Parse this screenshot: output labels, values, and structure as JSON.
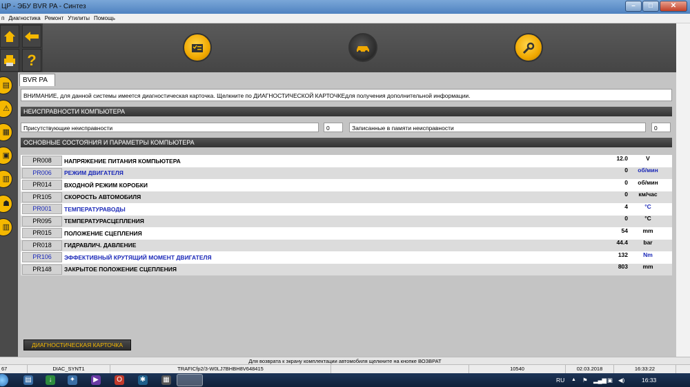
{
  "window": {
    "title": "ЦР - ЭБУ BVR PA - Синтез",
    "controls": {
      "minimize": "–",
      "maximize": "□",
      "close": "✕"
    }
  },
  "menu": [
    "п",
    "Диагностика",
    "Ремонт",
    "Утилиты",
    "Помощь"
  ],
  "toolbar": {
    "left_icons": [
      "home-icon",
      "back-arrow-icon",
      "printer-icon",
      "help-question-icon"
    ],
    "center_icons": [
      "checklist-icon",
      "car-diagnostic-icon",
      "wrench-icon"
    ]
  },
  "sidebar_icons": [
    "notebook-icon",
    "warning-icon",
    "ecu-icon",
    "clipboard-icon",
    "book-icon",
    "robot-icon",
    "barcode-icon"
  ],
  "tab": {
    "label": "BVR PA"
  },
  "notice": "ВНИМАНИЕ, для данной системы имеется диагностическая карточка. Щелкните по ДИАГНОСТИЧЕСКОЙ КАРТОЧКЕдля получения дополнительной информации.",
  "faults": {
    "section_title": "НЕИСПРАВНОСТИ КОМПЬЮТЕРА",
    "present_label": "Присутствующие неисправности",
    "present_count": "0",
    "stored_label": "Записанные в памяти неисправности",
    "stored_count": "0"
  },
  "params": {
    "section_title": "ОСНОВНЫЕ СОСТОЯНИЯ И ПАРАМЕТРЫ КОМПЬЮТЕРА",
    "rows": [
      {
        "code": "PR008",
        "name": "НАПРЯЖЕНИЕ ПИТАНИЯ КОМПЬЮТЕРА",
        "value": "12.0",
        "unit": "V",
        "highlight": false
      },
      {
        "code": "PR006",
        "name": "РЕЖИМ ДВИГАТЕЛЯ",
        "value": "0",
        "unit": "об/мин",
        "highlight": true
      },
      {
        "code": "PR014",
        "name": "ВХОДНОЙ РЕЖИМ КОРОБКИ",
        "value": "0",
        "unit": "об/мин",
        "highlight": false
      },
      {
        "code": "PR105",
        "name": "СКОРОСТЬ АВТОМОБИЛЯ",
        "value": "0",
        "unit": "км/час",
        "highlight": false
      },
      {
        "code": "PR001",
        "name": "ТЕМПЕРАТУРАВОДЫ",
        "value": "4",
        "unit": "°C",
        "highlight": true
      },
      {
        "code": "PR095",
        "name": "ТЕМПЕРАТУРАСЦЕПЛЕНИЯ",
        "value": "0",
        "unit": "°C",
        "highlight": false
      },
      {
        "code": "PR015",
        "name": "ПОЛОЖЕНИЕ СЦЕПЛЕНИЯ",
        "value": "54",
        "unit": "mm",
        "highlight": false
      },
      {
        "code": "PR018",
        "name": "ГИДРАВЛИЧ. ДАВЛЕНИЕ",
        "value": "44.4",
        "unit": "bar",
        "highlight": false
      },
      {
        "code": "PR106",
        "name": "ЭФФЕКТИВНЫЙ КРУТЯЩИЙ МОМЕНТ ДВИГАТЕЛЯ",
        "value": "132",
        "unit": "Nm",
        "highlight": true
      },
      {
        "code": "PR148",
        "name": "ЗАКРЫТОЕ ПОЛОЖЕНИЕ СЦЕПЛЕНИЯ",
        "value": "803",
        "unit": "mm",
        "highlight": false
      }
    ]
  },
  "diag_button": "ДИАГНОСТИЧЕСКАЯ КАРТОЧКА",
  "hint": "Для возврата к экрану комплектации автомобиля щелкните на кнопке ВОЗВРАТ",
  "status": {
    "left": "67",
    "profile": "DIAC_SYNT1",
    "vehicle": "TRAFICfp2/3-W0LJ7BHBH8V648415",
    "code": "10540",
    "date": "02.03.2018",
    "time": "16:33:22"
  },
  "taskbar": {
    "lang": "RU",
    "clock": "16:33",
    "tray_icons": [
      "show-hidden-icon",
      "flag-icon",
      "network-icon",
      "monitor-icon",
      "volume-icon"
    ]
  },
  "colors": {
    "accent": "#f5b800",
    "highlight_text": "#1a28b8",
    "header_dark": "#333333"
  }
}
